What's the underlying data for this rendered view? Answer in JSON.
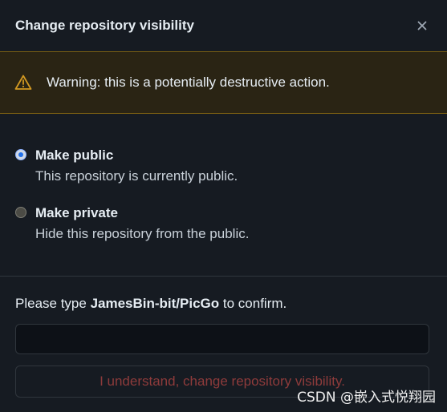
{
  "dialog": {
    "title": "Change repository visibility",
    "close_icon": "close-icon"
  },
  "warning": {
    "icon": "alert-triangle-icon",
    "text": "Warning: this is a potentially destructive action.",
    "color": "#d29922"
  },
  "options": [
    {
      "label": "Make public",
      "description": "This repository is currently public.",
      "checked": true
    },
    {
      "label": "Make private",
      "description": "Hide this repository from the public.",
      "checked": false
    }
  ],
  "confirm": {
    "prefix": "Please type ",
    "repo": "JamesBin-bit/PicGo",
    "suffix": " to confirm.",
    "input_value": "",
    "button_label": "I understand, change repository visibility."
  },
  "watermark": "CSDN @嵌入式悦翔园"
}
